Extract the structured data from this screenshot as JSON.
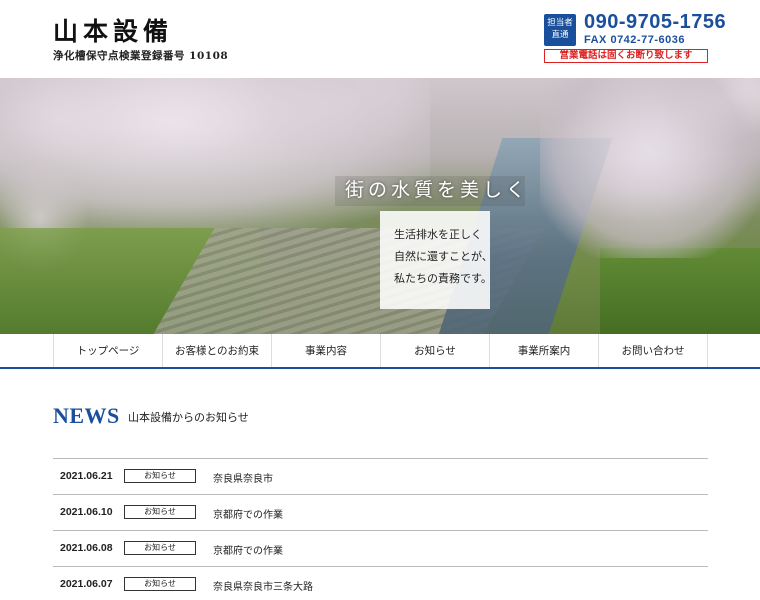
{
  "header": {
    "company_name": "山本設備",
    "license": "浄化槽保守点検業登録番号 10108",
    "contact_badge": "担当者直通",
    "phone": "090-9705-1756",
    "fax": "FAX 0742-77-6036",
    "notice": "営業電話は固くお断り致します"
  },
  "hero": {
    "title": "街の水質を美しく",
    "lines": [
      "生活排水を正しく",
      "自然に還すことが、",
      "私たちの責務です。"
    ]
  },
  "nav": {
    "items": [
      {
        "label": "トップページ"
      },
      {
        "label": "お客様とのお約束"
      },
      {
        "label": "事業内容"
      },
      {
        "label": "お知らせ"
      },
      {
        "label": "事業所案内"
      },
      {
        "label": "お問い合わせ"
      }
    ]
  },
  "news": {
    "title": "NEWS",
    "subtitle": "山本設備からのお知らせ",
    "items": [
      {
        "date": "2021.06.21",
        "tag": "お知らせ",
        "text": "奈良県奈良市"
      },
      {
        "date": "2021.06.10",
        "tag": "お知らせ",
        "text": "京都府での作業"
      },
      {
        "date": "2021.06.08",
        "tag": "お知らせ",
        "text": "京都府での作業"
      },
      {
        "date": "2021.06.07",
        "tag": "お知らせ",
        "text": "奈良県奈良市三条大路"
      }
    ]
  },
  "colors": {
    "accent": "#1a4f9c",
    "notice": "#dd2222"
  }
}
